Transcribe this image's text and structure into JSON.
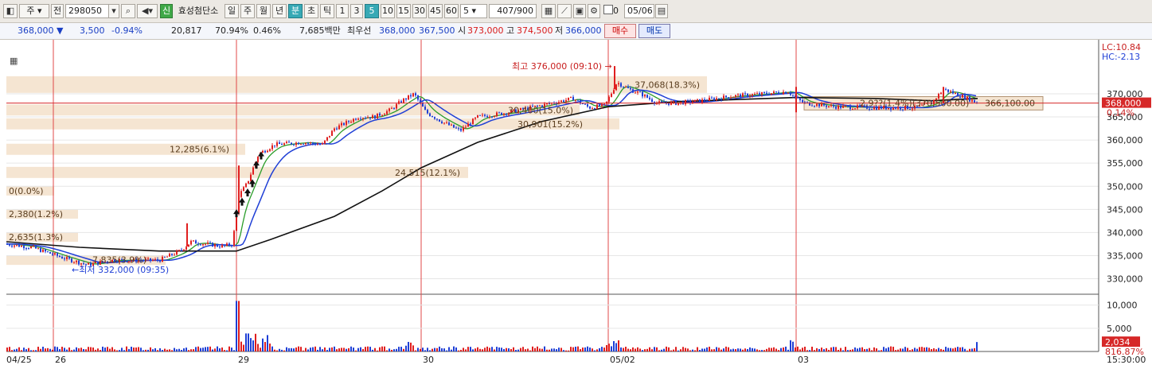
{
  "toolbar": {
    "item_code": "298050",
    "type_label": "주",
    "all_label": "전",
    "stock_name": "효성첨단소",
    "credit_badge": "신",
    "periods": [
      "일",
      "주",
      "월",
      "년"
    ],
    "period_active": "분",
    "period_after": [
      "초",
      "틱"
    ],
    "minutes": [
      "1",
      "3",
      "5",
      "10",
      "15",
      "30",
      "45",
      "60"
    ],
    "minute_active": "5",
    "count_value": "5",
    "bar_count": "407/900",
    "checkbox_label": "0",
    "date_value": "05/06"
  },
  "infobar": {
    "price": "368,000",
    "change": "3,500",
    "change_pct": "-0.94%",
    "volume": "20,817",
    "volume_ratio": "70.94%",
    "turnover": "0.46%",
    "amount": "7,685백만",
    "best_quote_label": "최우선",
    "ask": "368,000",
    "bid": "367,500",
    "open_label": "시",
    "open": "373,000",
    "high_label": "고",
    "high": "374,500",
    "low_label": "저",
    "low": "366,000",
    "buy_label": "매수",
    "sell_label": "매도"
  },
  "colors": {
    "up": "#e01e1e",
    "down": "#1f3fd6",
    "ma1": "#1f3fd6",
    "ma2": "#2a9d2a",
    "ma3": "#111111",
    "band": "#f5e5d2"
  },
  "chart_data": {
    "type": "candlestick",
    "y_range": [
      327000,
      381000
    ],
    "y_ticks": [
      "370,000",
      "365,000",
      "360,000",
      "355,000",
      "350,000",
      "345,000",
      "340,000",
      "335,000",
      "330,000"
    ],
    "y_tick_values": [
      370000,
      365000,
      360000,
      355000,
      350000,
      345000,
      340000,
      335000,
      330000
    ],
    "x_labels": [
      "04/25",
      "26",
      "29",
      "30",
      "05/02",
      "03"
    ],
    "right_info": [
      "LC:10.84",
      "HC:-2.13"
    ],
    "current_price_tag": "368,000",
    "current_pct_tag": "0.14%",
    "current_price": 368000,
    "high_marker": "최고 376,000 (09:10)",
    "low_marker": "최저 332,000 (09:35)",
    "band_labels": [
      "37,068(18.3%)",
      "30,400(15.0%)",
      "30,901(15.2%)",
      "12,285(6.1%)",
      "24,515(12.1%)",
      "0(0.0%)",
      "2,380(1.2%)",
      "2,635(1.3%)",
      "7,835(3.9%)",
      "2,9??(1.4%)(370,500.00)",
      "366,100.00"
    ],
    "band_values": [
      372000,
      366500,
      363500,
      358000,
      353000,
      349000,
      344000,
      339000,
      334000
    ],
    "volume_ticks": [
      "10,000",
      "5,000"
    ],
    "volume_tick_values": [
      10000,
      5000
    ],
    "volume_tag": "2,034",
    "volume_pct_tag": "816.87%",
    "volume_last": 2034,
    "time_label": "15:30:00"
  }
}
